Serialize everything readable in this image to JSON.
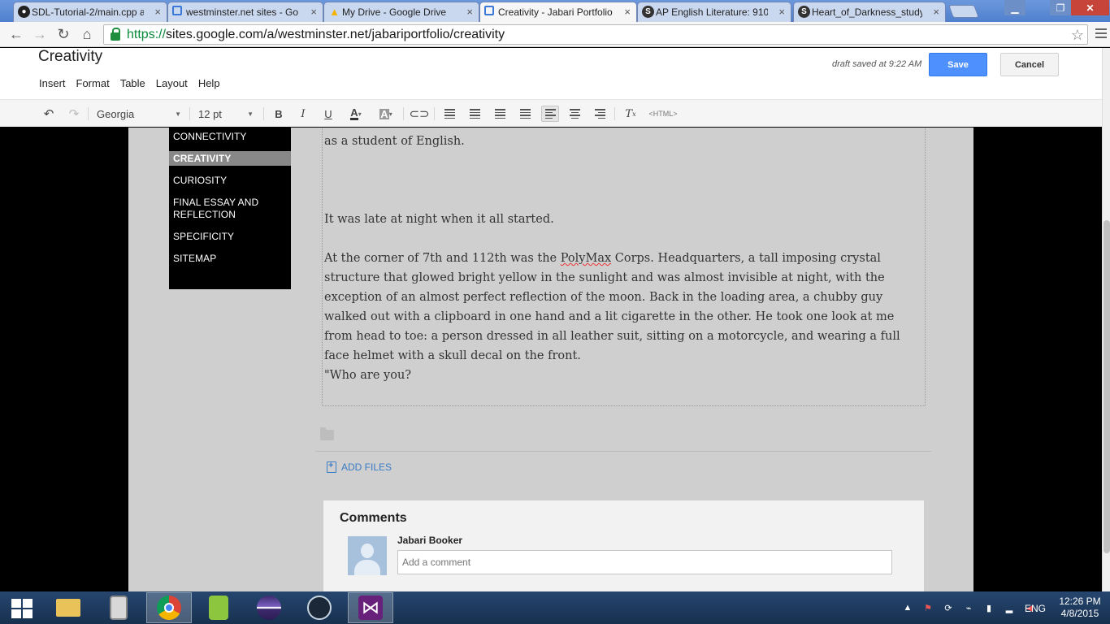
{
  "browser": {
    "tabs": [
      {
        "title": "SDL-Tutorial-2/main.cpp a",
        "icon": "github-icon"
      },
      {
        "title": "westminster.net sites - Go",
        "icon": "sites-icon"
      },
      {
        "title": "My Drive - Google Drive",
        "icon": "drive-icon"
      },
      {
        "title": "Creativity - Jabari Portfolio",
        "icon": "sites-icon"
      },
      {
        "title": "AP English Literature: 910",
        "icon": "schoology-icon"
      },
      {
        "title": "Heart_of_Darkness_study_",
        "icon": "schoology-icon"
      }
    ],
    "url_scheme": "https://",
    "url_rest": "sites.google.com/a/westminster.net/jabariportfolio/creativity"
  },
  "editor": {
    "page_title": "Creativity",
    "menu": [
      "Insert",
      "Format",
      "Table",
      "Layout",
      "Help"
    ],
    "draft_status": "draft saved at 9:22 AM",
    "save_label": "Save",
    "cancel_label": "Cancel",
    "font": "Georgia",
    "font_size": "12 pt",
    "html_label": "<HTML>"
  },
  "sidebar": {
    "items": [
      {
        "label": "CONNECTIVITY"
      },
      {
        "label": "CREATIVITY",
        "active": true
      },
      {
        "label": "CURIOSITY"
      },
      {
        "label": "FINAL ESSAY AND REFLECTION"
      },
      {
        "label": "SPECIFICITY"
      },
      {
        "label": "SITEMAP"
      }
    ]
  },
  "content": {
    "p0": "as a student of English.",
    "p1": "It was late at night when it all started.",
    "p2_before": "At the corner of 7th and 112th was the ",
    "p2_spell": "PolyMax",
    "p2_after": " Corps. Headquarters,  a tall imposing crystal structure that glowed bright yellow in the sunlight and was almost invisible at night, with the exception of an almost perfect reflection of the moon. Back in the loading area, a chubby guy walked out with a clipboard in one hand and a lit cigarette in the other. He took one look at me from head to toe: a person dressed in all leather suit, sitting on a motorcycle, and wearing a full face helmet with a skull decal on the front.",
    "p3": "\"Who are you?"
  },
  "attachments": {
    "add_files_label": "ADD FILES"
  },
  "comments": {
    "title": "Comments",
    "user": "Jabari Booker",
    "placeholder": "Add a comment"
  },
  "taskbar": {
    "language": "ENG",
    "time": "12:26 PM",
    "date": "4/8/2015"
  },
  "colors": {
    "save_button": "#4d90fe",
    "link": "#3b7cc4",
    "sidebar_bg": "#000000",
    "page_bg": "#cfcfcf"
  }
}
